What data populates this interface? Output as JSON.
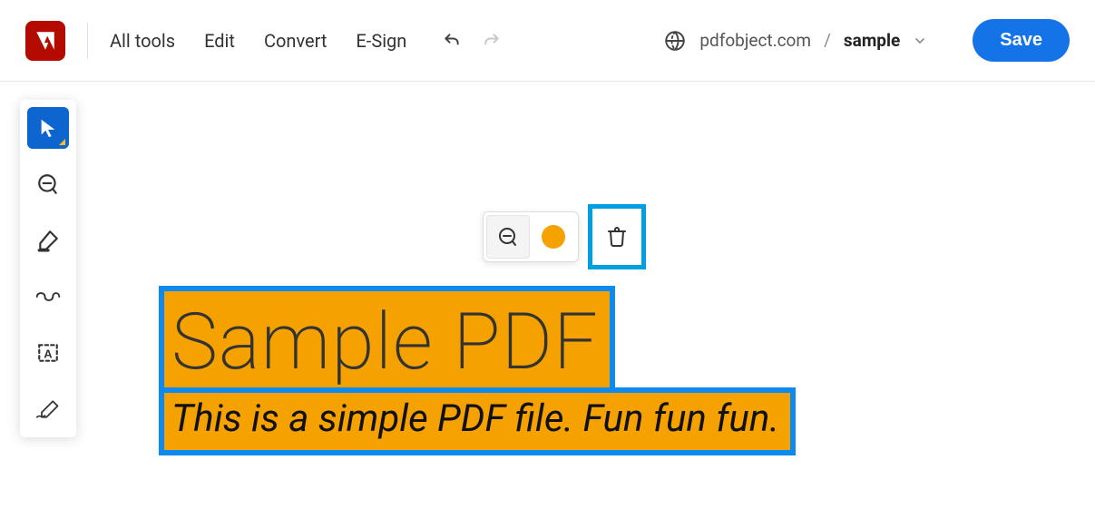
{
  "header": {
    "menu": {
      "all_tools": "All tools",
      "edit": "Edit",
      "convert": "Convert",
      "esign": "E-Sign"
    },
    "crumb": {
      "host": "pdfobject.com",
      "sep": "/",
      "filename": "sample"
    },
    "save_label": "Save"
  },
  "sidebar": {
    "tools": [
      {
        "name": "select",
        "active": true
      },
      {
        "name": "comment",
        "active": false
      },
      {
        "name": "highlight",
        "active": false
      },
      {
        "name": "draw-freeform",
        "active": false
      },
      {
        "name": "add-text-box",
        "active": false
      },
      {
        "name": "sign",
        "active": false
      }
    ]
  },
  "context_toolbar": {
    "color": "#f5a100",
    "delete_highlighted": true
  },
  "document": {
    "highlight": {
      "line1": "Sample PDF",
      "line2": "This is a simple PDF file. Fun fun fun."
    }
  }
}
